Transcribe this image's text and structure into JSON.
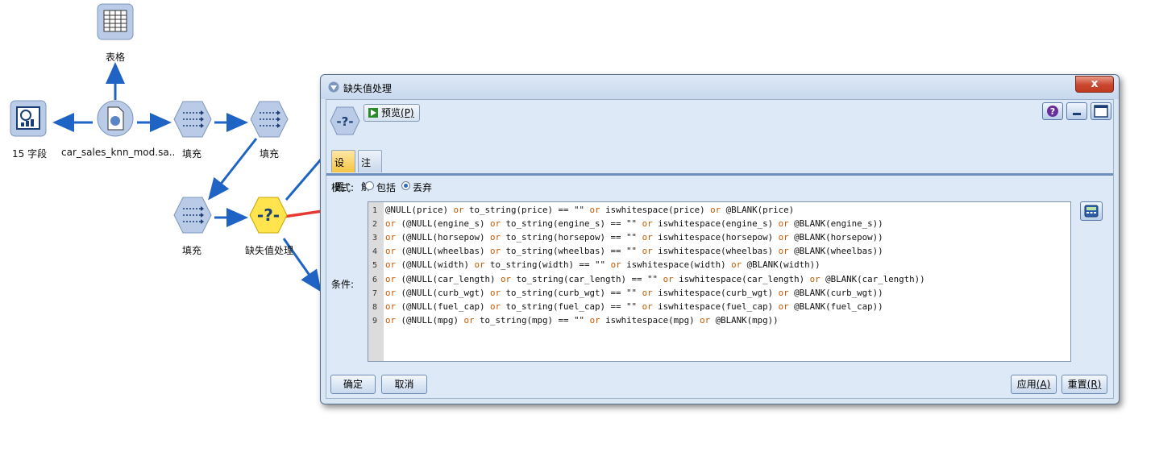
{
  "stream": {
    "nodes": {
      "table": "表格",
      "fields": "15 字段",
      "source": "car_sales_knn_mod.sa..",
      "fill1": "填充",
      "fill2": "填充",
      "fill3": "填充",
      "missing": "缺失值处理"
    }
  },
  "dialog": {
    "title": "缺失值处理",
    "close": "x",
    "preview_label": "预览",
    "preview_hotkey": "(P)",
    "tabs": [
      "设置",
      "注解"
    ],
    "mode_label": "模式:",
    "mode_options": [
      "包括",
      "丢弃"
    ],
    "mode_selected": "丢弃",
    "condition_label": "条件:",
    "code_lines": [
      [
        "@NULL(price) ",
        {
          "kw": "or"
        },
        " to_string(price) == \"\" ",
        {
          "kw": "or"
        },
        " iswhitespace(price) ",
        {
          "kw": "or"
        },
        " @BLANK(price)"
      ],
      [
        {
          "kw": "or"
        },
        " (@NULL(engine_s) ",
        {
          "kw": "or"
        },
        " to_string(engine_s) == \"\" ",
        {
          "kw": "or"
        },
        " iswhitespace(engine_s) ",
        {
          "kw": "or"
        },
        " @BLANK(engine_s))"
      ],
      [
        {
          "kw": "or"
        },
        " (@NULL(horsepow) ",
        {
          "kw": "or"
        },
        " to_string(horsepow) == \"\" ",
        {
          "kw": "or"
        },
        " iswhitespace(horsepow) ",
        {
          "kw": "or"
        },
        " @BLANK(horsepow))"
      ],
      [
        {
          "kw": "or"
        },
        " (@NULL(wheelbas) ",
        {
          "kw": "or"
        },
        " to_string(wheelbas) == \"\" ",
        {
          "kw": "or"
        },
        " iswhitespace(wheelbas) ",
        {
          "kw": "or"
        },
        " @BLANK(wheelbas))"
      ],
      [
        {
          "kw": "or"
        },
        " (@NULL(width) ",
        {
          "kw": "or"
        },
        " to_string(width) == \"\" ",
        {
          "kw": "or"
        },
        " iswhitespace(width) ",
        {
          "kw": "or"
        },
        " @BLANK(width))"
      ],
      [
        {
          "kw": "or"
        },
        " (@NULL(car_length) ",
        {
          "kw": "or"
        },
        " to_string(car_length) == \"\" ",
        {
          "kw": "or"
        },
        " iswhitespace(car_length) ",
        {
          "kw": "or"
        },
        " @BLANK(car_length))"
      ],
      [
        {
          "kw": "or"
        },
        " (@NULL(curb_wgt) ",
        {
          "kw": "or"
        },
        " to_string(curb_wgt) == \"\" ",
        {
          "kw": "or"
        },
        " iswhitespace(curb_wgt) ",
        {
          "kw": "or"
        },
        " @BLANK(curb_wgt))"
      ],
      [
        {
          "kw": "or"
        },
        " (@NULL(fuel_cap) ",
        {
          "kw": "or"
        },
        " to_string(fuel_cap) == \"\" ",
        {
          "kw": "or"
        },
        " iswhitespace(fuel_cap) ",
        {
          "kw": "or"
        },
        " @BLANK(fuel_cap))"
      ],
      [
        {
          "kw": "or"
        },
        " (@NULL(mpg) ",
        {
          "kw": "or"
        },
        " to_string(mpg) == \"\" ",
        {
          "kw": "or"
        },
        " iswhitespace(mpg) ",
        {
          "kw": "or"
        },
        " @BLANK(mpg))"
      ]
    ],
    "buttons": {
      "ok": "确定",
      "cancel": "取消",
      "apply": "应用",
      "apply_hotkey": "(A)",
      "reset": "重置",
      "reset_hotkey": "(R)"
    },
    "colors": {
      "keyword": "#c85a00",
      "accent_tab": "#f5c542",
      "close": "#c9472d",
      "arrow": "#e53935"
    }
  }
}
